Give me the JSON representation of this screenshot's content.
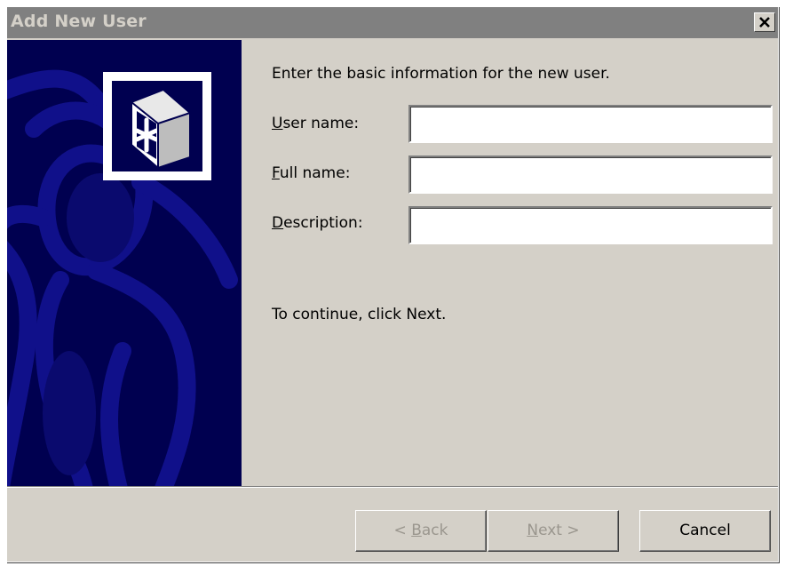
{
  "window": {
    "title": "Add New User",
    "close_symbol": "close-icon"
  },
  "sidebar": {
    "logo_icon": "user-wizard-icon",
    "bg_color": "#000050"
  },
  "main": {
    "intro_text": "Enter the basic information for the new user.",
    "fields": [
      {
        "label_access": "U",
        "label_rest": "ser name:",
        "value": ""
      },
      {
        "label_access": "F",
        "label_rest": "ull name:",
        "value": ""
      },
      {
        "label_access": "D",
        "label_rest": "escription:",
        "value": ""
      }
    ],
    "continue_text": "To continue, click Next."
  },
  "buttons": {
    "back_prefix": "< ",
    "back_access": "B",
    "back_rest": "ack",
    "next_access": "N",
    "next_rest": "ext >",
    "cancel": "Cancel"
  }
}
